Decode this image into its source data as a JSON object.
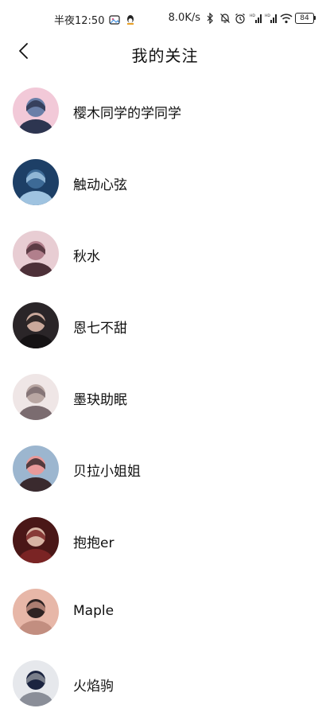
{
  "status_bar": {
    "time": "半夜12:50",
    "network_speed": "8.0K/s",
    "battery": "84",
    "icons": [
      "picture-icon",
      "qq-icon",
      "bluetooth-icon",
      "mute-icon",
      "alarm-icon",
      "signal-hd-icon",
      "signal-hd-icon",
      "wifi-icon",
      "battery-icon"
    ]
  },
  "header": {
    "back_icon": "chevron-left-icon",
    "title": "我的关注"
  },
  "follows": [
    {
      "name": "樱木同学的学同学",
      "avatar_palette": [
        "#f2c9d8",
        "#6a7fa8",
        "#2d3550"
      ]
    },
    {
      "name": "触动心弦",
      "avatar_palette": [
        "#1d3f66",
        "#3d6a96",
        "#9fc3e0"
      ]
    },
    {
      "name": "秋水",
      "avatar_palette": [
        "#e8cdd3",
        "#b17f8c",
        "#4d3038"
      ]
    },
    {
      "name": "恩七不甜",
      "avatar_palette": [
        "#2a2528",
        "#c9a89b",
        "#151214"
      ]
    },
    {
      "name": "墨玦助眠",
      "avatar_palette": [
        "#efe6e6",
        "#b9a7a3",
        "#7b6c70"
      ]
    },
    {
      "name": "贝拉小姐姐",
      "avatar_palette": [
        "#9cb6cf",
        "#e89a9a",
        "#3a2a2e"
      ]
    },
    {
      "name": "抱抱er",
      "avatar_palette": [
        "#4a1717",
        "#d8b4a4",
        "#7a2424"
      ]
    },
    {
      "name": "Maple",
      "avatar_palette": [
        "#e7b7a8",
        "#2e2323",
        "#c28e80"
      ]
    },
    {
      "name": "火焰驹",
      "avatar_palette": [
        "#e6e8ec",
        "#1b2440",
        "#8a8e98"
      ]
    }
  ]
}
